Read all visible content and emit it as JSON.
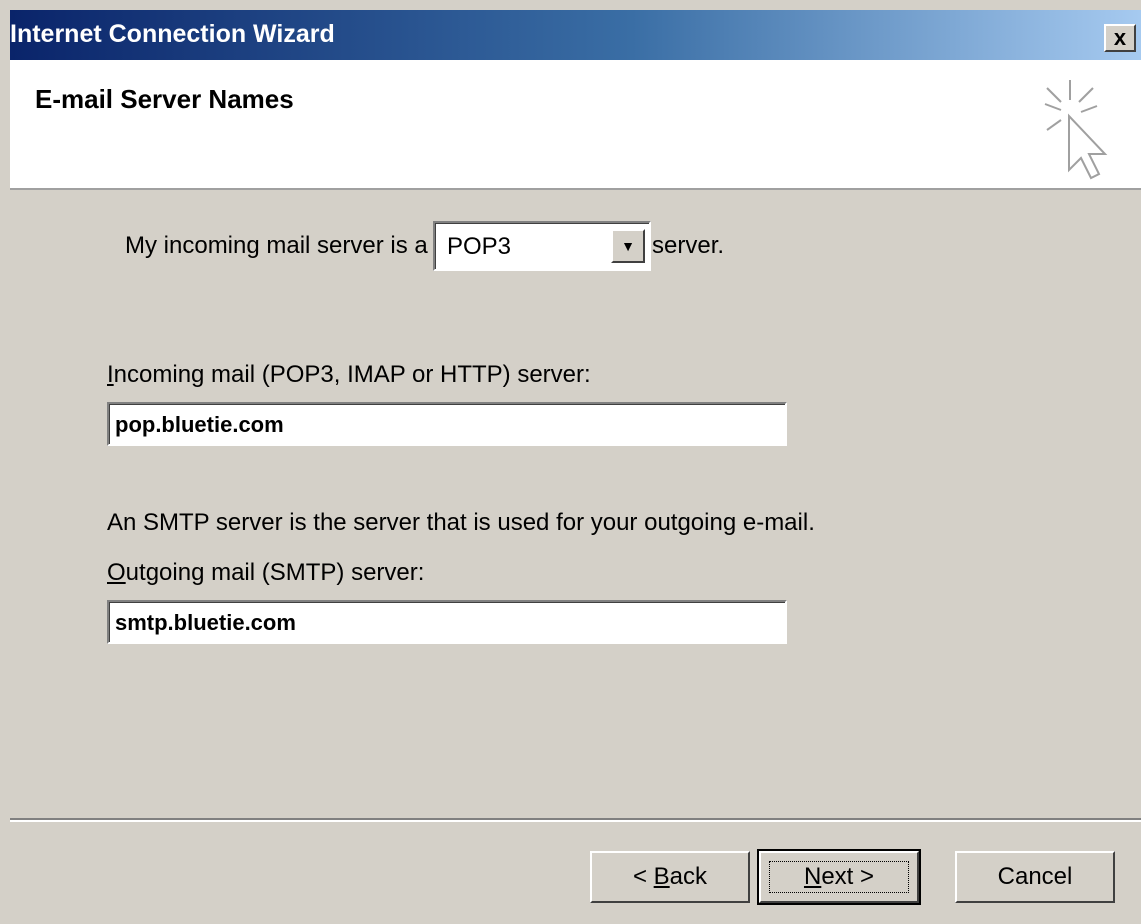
{
  "window": {
    "title": "Internet Connection Wizard",
    "close_glyph": "x"
  },
  "header": {
    "title": "E-mail Server Names",
    "icon": "wizard-cursor-icon"
  },
  "form": {
    "incoming_type_prefix": "My incoming mail server is a",
    "incoming_type_value": "POP3",
    "incoming_type_suffix": "server.",
    "incoming_label": "Incoming mail (POP3, IMAP or HTTP) server:",
    "incoming_value": "pop.bluetie.com",
    "smtp_explanation": "An SMTP server is the server that is used for your outgoing e-mail.",
    "outgoing_label": "Outgoing mail (SMTP) server:",
    "outgoing_value": "smtp.bluetie.com"
  },
  "buttons": {
    "back_prefix": "< ",
    "back_mnemonic": "B",
    "back_rest": "ack",
    "next_mnemonic": "N",
    "next_rest": "ext >",
    "cancel": "Cancel"
  },
  "colors": {
    "title_bar_start": "#0a246a",
    "title_bar_end": "#a6caf0",
    "dialog_face": "#d4d0c8"
  }
}
